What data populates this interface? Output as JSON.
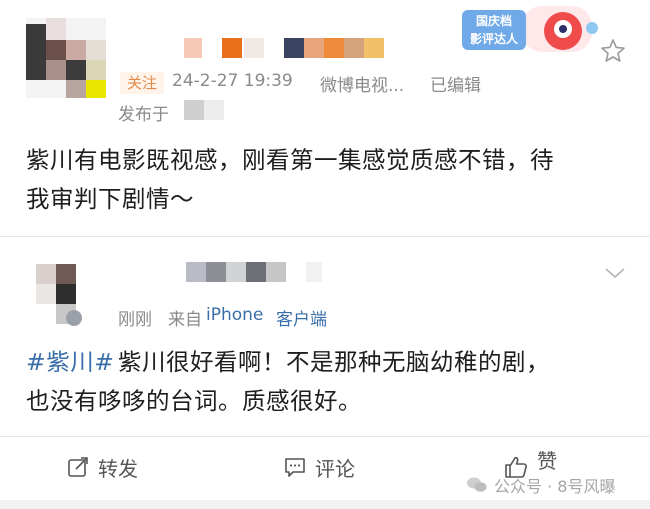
{
  "post": {
    "tag_fragment": "关注",
    "timestamp": "24-2-27 19:39",
    "source": "微博电视...",
    "edited": "已编辑",
    "location_prefix": "发布于",
    "text_line1": "紫川有电影既视感，刚看第一集感觉质感不错，待",
    "text_line2": "我审判下剧情～",
    "badge_line1": "国庆档",
    "badge_line2": "影评达人"
  },
  "reply": {
    "time": "刚刚",
    "source_prefix": "来自",
    "device": "iPhone",
    "client": "客户端",
    "topic": "#紫川#",
    "text_line1_rest": "紫川很好看啊！不是那种无脑幼稚的剧，",
    "text_line2": "也没有哆哆的台词。质感很好。"
  },
  "actions": {
    "repost": "转发",
    "comment": "评论",
    "like": "赞"
  },
  "watermark": {
    "text": "公众号 · 8号风曝"
  },
  "colors": {
    "link": "#3a6ea8",
    "meta": "#8a8a8a",
    "star": "#999999"
  }
}
